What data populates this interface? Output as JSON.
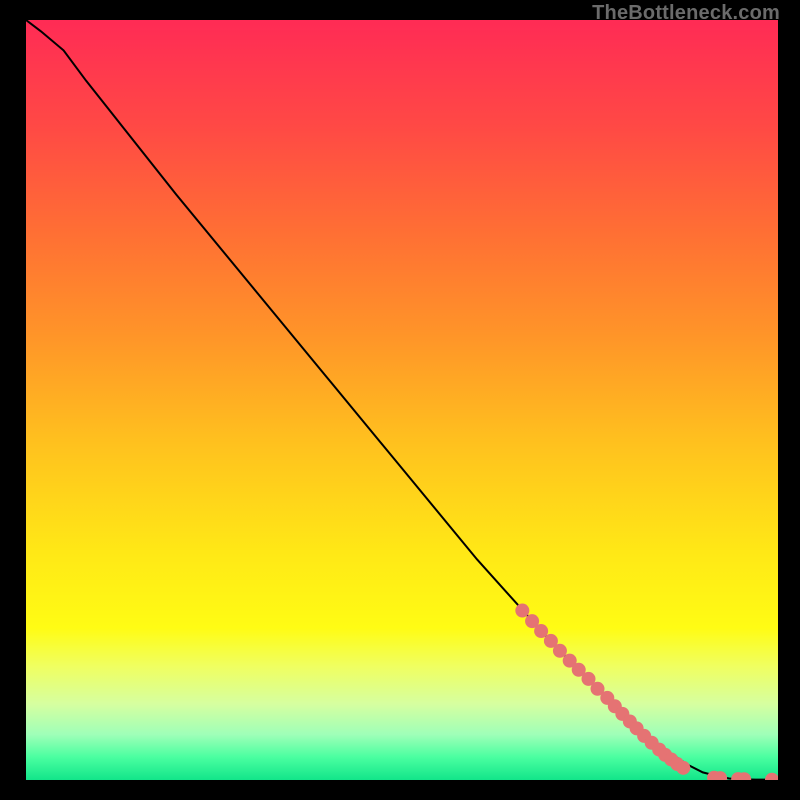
{
  "watermark": "TheBottleneck.com",
  "chart_data": {
    "type": "line",
    "title": "",
    "xlabel": "",
    "ylabel": "",
    "xlim": [
      0,
      100
    ],
    "ylim": [
      0,
      100
    ],
    "grid": false,
    "legend": false,
    "background_gradient": {
      "stops": [
        {
          "offset": 0.0,
          "color": "#ff2b55"
        },
        {
          "offset": 0.14,
          "color": "#ff4945"
        },
        {
          "offset": 0.28,
          "color": "#ff6f34"
        },
        {
          "offset": 0.42,
          "color": "#ff9628"
        },
        {
          "offset": 0.56,
          "color": "#ffc21e"
        },
        {
          "offset": 0.7,
          "color": "#ffe816"
        },
        {
          "offset": 0.8,
          "color": "#fffc14"
        },
        {
          "offset": 0.85,
          "color": "#f0ff60"
        },
        {
          "offset": 0.9,
          "color": "#d6ffa0"
        },
        {
          "offset": 0.94,
          "color": "#9fffb8"
        },
        {
          "offset": 0.97,
          "color": "#4affa0"
        },
        {
          "offset": 1.0,
          "color": "#12e58a"
        }
      ]
    },
    "series": [
      {
        "name": "curve",
        "color": "#000000",
        "width": 2,
        "x": [
          0,
          2,
          5,
          8,
          12,
          20,
          30,
          40,
          50,
          60,
          70,
          80,
          85,
          88,
          90,
          92,
          93.5,
          95,
          97,
          100
        ],
        "y": [
          100,
          98.5,
          96,
          92,
          87,
          77,
          65,
          53,
          41,
          29,
          18,
          8,
          4,
          2,
          1,
          0.5,
          0.2,
          0.1,
          0.05,
          0.03
        ]
      }
    ],
    "dot_sequences": [
      {
        "name": "thick-dotted-segment",
        "color": "#e57373",
        "radius_px": 7,
        "points": [
          {
            "x": 66,
            "y": 22.3
          },
          {
            "x": 67.3,
            "y": 20.9
          },
          {
            "x": 68.5,
            "y": 19.6
          },
          {
            "x": 69.8,
            "y": 18.3
          },
          {
            "x": 71.0,
            "y": 17.0
          },
          {
            "x": 72.3,
            "y": 15.7
          },
          {
            "x": 73.5,
            "y": 14.5
          },
          {
            "x": 74.8,
            "y": 13.3
          },
          {
            "x": 76.0,
            "y": 12.0
          },
          {
            "x": 77.3,
            "y": 10.8
          },
          {
            "x": 78.3,
            "y": 9.7
          },
          {
            "x": 79.3,
            "y": 8.7
          },
          {
            "x": 80.3,
            "y": 7.7
          },
          {
            "x": 81.2,
            "y": 6.8
          },
          {
            "x": 82.2,
            "y": 5.8
          },
          {
            "x": 83.2,
            "y": 4.9
          },
          {
            "x": 84.2,
            "y": 4.0
          },
          {
            "x": 85.0,
            "y": 3.3
          },
          {
            "x": 85.8,
            "y": 2.7
          },
          {
            "x": 86.6,
            "y": 2.1
          },
          {
            "x": 87.4,
            "y": 1.6
          }
        ]
      },
      {
        "name": "tail-dots",
        "color": "#e57373",
        "radius_px": 7,
        "points": [
          {
            "x": 91.5,
            "y": 0.3
          },
          {
            "x": 92.3,
            "y": 0.25
          },
          {
            "x": 94.7,
            "y": 0.12
          },
          {
            "x": 95.5,
            "y": 0.1
          },
          {
            "x": 99.2,
            "y": 0.03
          }
        ]
      }
    ]
  }
}
